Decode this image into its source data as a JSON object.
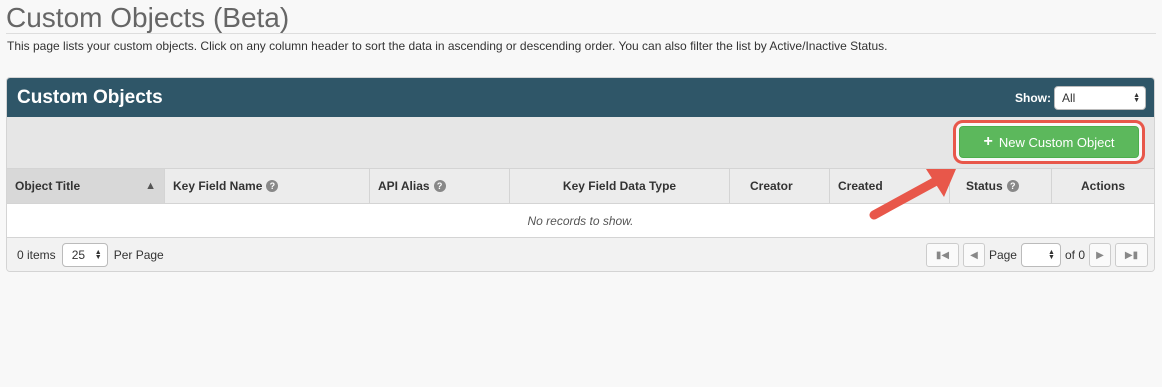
{
  "header": {
    "title": "Custom Objects (Beta)",
    "description": "This page lists your custom objects. Click on any column header to sort the data in ascending or descending order. You can also filter the list by Active/Inactive Status."
  },
  "panel": {
    "title": "Custom Objects",
    "show_label": "Show:",
    "show_value": "All"
  },
  "toolbar": {
    "new_button_label": "New Custom Object",
    "new_button_icon": "plus-icon"
  },
  "grid": {
    "columns": [
      {
        "label": "Object Title",
        "help": false,
        "sorted": true
      },
      {
        "label": "Key Field Name",
        "help": true
      },
      {
        "label": "API Alias",
        "help": true
      },
      {
        "label": "Key Field Data Type",
        "help": false
      },
      {
        "label": "Creator",
        "help": false
      },
      {
        "label": "Created",
        "help": false
      },
      {
        "label": "Status",
        "help": true
      },
      {
        "label": "Actions",
        "help": false
      }
    ],
    "empty_message": "No records to show."
  },
  "footer": {
    "items_count": "0 items",
    "per_page_value": "25",
    "per_page_label": "Per Page",
    "page_label": "Page",
    "page_value": "",
    "of_label": "of 0"
  },
  "colors": {
    "header_bar": "#2f5668",
    "new_button": "#5cb85c",
    "highlight": "#e8574a"
  }
}
